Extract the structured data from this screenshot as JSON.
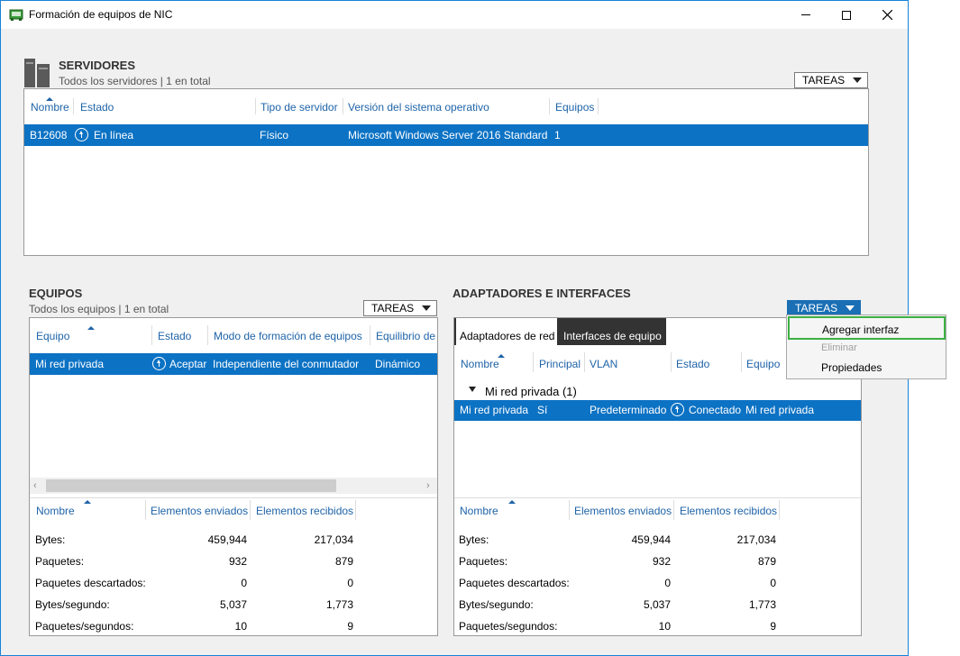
{
  "window": {
    "title": "Formación de equipos de NIC"
  },
  "servers": {
    "title": "SERVIDORES",
    "subtitle": "Todos los servidores | 1 en total",
    "tasks_label": "TAREAS",
    "columns": [
      "Nombre",
      "Estado",
      "Tipo de servidor",
      "Versión del sistema operativo",
      "Equipos"
    ],
    "rows": [
      {
        "name": "B12608",
        "status": "En línea",
        "type": "Físico",
        "os": "Microsoft Windows Server 2016 Standard",
        "teams": "1"
      }
    ]
  },
  "teams": {
    "title": "EQUIPOS",
    "subtitle": "Todos los equipos | 1 en total",
    "tasks_label": "TAREAS",
    "columns": [
      "Equipo",
      "Estado",
      "Modo de formación de equipos",
      "Equilibrio de"
    ],
    "rows": [
      {
        "team": "Mi red privada",
        "status": "Aceptar",
        "mode": "Independiente del conmutador",
        "balance": "Dinámico"
      }
    ],
    "stats_columns": [
      "Nombre",
      "Elementos enviados",
      "Elementos recibidos"
    ],
    "stats": [
      {
        "label": "Bytes:",
        "sent": "459,944",
        "received": "217,034"
      },
      {
        "label": "Paquetes:",
        "sent": "932",
        "received": "879"
      },
      {
        "label": "Paquetes descartados:",
        "sent": "0",
        "received": "0"
      },
      {
        "label": "Bytes/segundo:",
        "sent": "5,037",
        "received": "1,773"
      },
      {
        "label": "Paquetes/segundos:",
        "sent": "10",
        "received": "9"
      }
    ]
  },
  "adapters": {
    "title": "ADAPTADORES E INTERFACES",
    "tasks_label": "TAREAS",
    "tabs": [
      "Adaptadores de red",
      "Interfaces de equipo"
    ],
    "columns": [
      "Nombre",
      "Principal",
      "VLAN",
      "Estado",
      "Equipo"
    ],
    "group_label": "Mi red privada (1)",
    "rows": [
      {
        "name": "Mi red privada",
        "primary": "Sí",
        "vlan": "Predeterminado",
        "status": "Conectado",
        "team": "Mi red privada"
      }
    ],
    "stats_columns": [
      "Nombre",
      "Elementos enviados",
      "Elementos recibidos"
    ],
    "stats": [
      {
        "label": "Bytes:",
        "sent": "459,944",
        "received": "217,034"
      },
      {
        "label": "Paquetes:",
        "sent": "932",
        "received": "879"
      },
      {
        "label": "Paquetes descartados:",
        "sent": "0",
        "received": "0"
      },
      {
        "label": "Bytes/segundo:",
        "sent": "5,037",
        "received": "1,773"
      },
      {
        "label": "Paquetes/segundos:",
        "sent": "10",
        "received": "9"
      }
    ]
  },
  "tasks_menu": {
    "items": [
      "Agregar interfaz",
      "Eliminar",
      "Propiedades"
    ],
    "highlight_color": "#3cb043"
  },
  "colors": {
    "accent": "#0c72c4",
    "header_text": "#1e63a8"
  }
}
